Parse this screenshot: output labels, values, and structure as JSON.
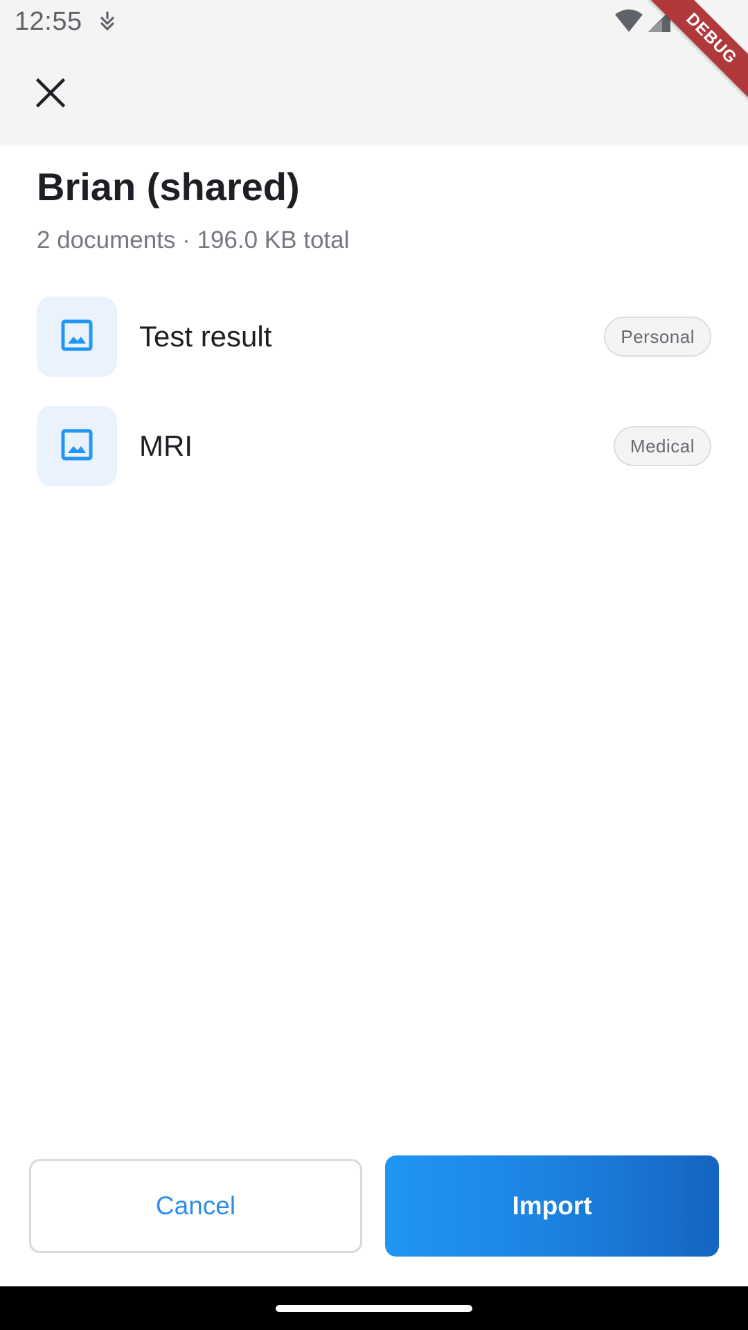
{
  "status_bar": {
    "time": "12:55",
    "icons": [
      "notification-icon",
      "wifi-icon",
      "signal-icon"
    ],
    "debug_banner": "DEBUG"
  },
  "app_bar": {
    "close_icon": "close-icon"
  },
  "header": {
    "title": "Brian (shared)",
    "subtitle": "2 documents · 196.0 KB total"
  },
  "documents": [
    {
      "name": "Test result",
      "tag": "Personal",
      "icon": "image-icon"
    },
    {
      "name": "MRI",
      "tag": "Medical",
      "icon": "image-icon"
    }
  ],
  "actions": {
    "cancel_label": "Cancel",
    "import_label": "Import"
  },
  "colors": {
    "accent": "#2196f3",
    "accent_dark": "#1565c0",
    "thumb_bg": "#e9f2fd",
    "debug_banner": "#b0393c"
  }
}
